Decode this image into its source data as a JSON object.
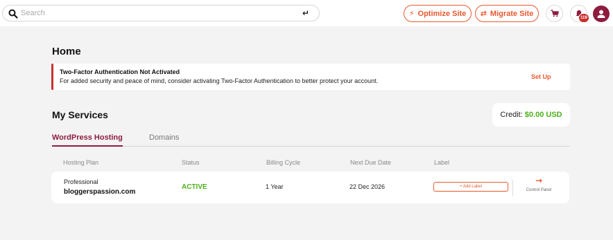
{
  "search": {
    "placeholder": "Search",
    "enter_icon": "↵"
  },
  "header": {
    "optimize_label": "Optimize Site",
    "migrate_label": "Migrate Site",
    "notification_count": "119",
    "icons": [
      "search-icon",
      "enter-icon",
      "lightning-icon",
      "swap-arrows-icon",
      "cart-icon",
      "bell-icon",
      "user-avatar-icon"
    ]
  },
  "page": {
    "title": "Home"
  },
  "alert": {
    "title": "Two-Factor Authentication Not Activated",
    "text": "For added security and peace of mind, consider activating Two-Factor Authentication to better protect your account.",
    "action_label": "Set Up"
  },
  "services": {
    "title": "My Services",
    "credit_label": "Credit:",
    "credit_amount": "$0.00 USD",
    "tabs": [
      {
        "label": "WordPress Hosting",
        "active": true
      },
      {
        "label": "Domains",
        "active": false
      }
    ],
    "columns": [
      "Hosting Plan",
      "Status",
      "Billing Cycle",
      "Next Due Date",
      "Label"
    ],
    "rows": [
      {
        "plan": "Professional",
        "domain": "bloggerspassion.com",
        "status": "ACTIVE",
        "cycle": "1 Year",
        "due": "22 Dec 2026",
        "add_label": "+ Add Label",
        "control_panel": "Control Panel"
      }
    ]
  },
  "colors": {
    "accent": "#e8572e",
    "brand": "#8e1c3f",
    "success": "#4caf1a",
    "alert_bar": "#c9302c",
    "background": "#f3f3f3"
  }
}
